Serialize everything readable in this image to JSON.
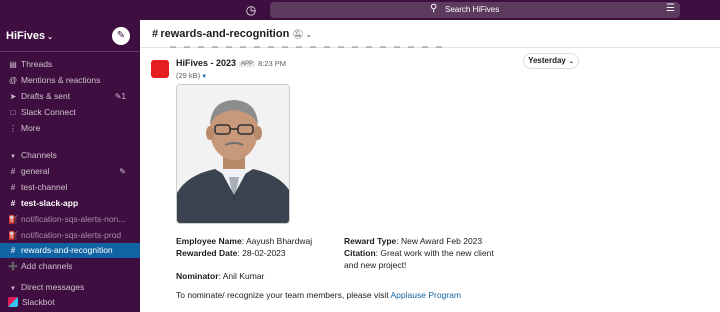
{
  "topbar": {
    "history_icon": "clock-icon",
    "search_placeholder": "Search HiFives",
    "search_icon": "search-icon",
    "filter_icon": "sliders-icon"
  },
  "sidebar": {
    "workspace": "HiFives",
    "compose_icon": "compose-icon",
    "top_items": [
      {
        "icon": "threads-icon",
        "label": "Threads"
      },
      {
        "icon": "at-icon",
        "label": "Mentions & reactions"
      },
      {
        "icon": "send-icon",
        "label": "Drafts & sent",
        "count": "1"
      },
      {
        "icon": "connect-icon",
        "label": "Slack Connect"
      },
      {
        "icon": "more-icon",
        "label": "More"
      }
    ],
    "channels_header": "Channels",
    "channels": [
      {
        "label": "general",
        "type": "public"
      },
      {
        "label": "test-channel",
        "type": "public"
      },
      {
        "label": "test-slack-app",
        "type": "public",
        "bold": true
      },
      {
        "label": "notification-sqs-alerts-non...",
        "type": "private"
      },
      {
        "label": "notification-sqs-alerts-prod",
        "type": "private"
      },
      {
        "label": "rewards-and-recognition",
        "type": "public",
        "active": true
      }
    ],
    "add_channels": "Add channels",
    "dm_header": "Direct messages",
    "dms": [
      {
        "label": "Slackbot"
      }
    ]
  },
  "channel": {
    "name": "rewards-and-recognition",
    "date_divider": "Yesterday"
  },
  "message": {
    "sender": "HiFives - 2023",
    "badge": "APP",
    "time": "8:23 PM",
    "file_size": "(29 kB)",
    "employee_name_label": "Employee Name",
    "employee_name": "Aayush Bhardwaj",
    "rewarded_date_label": "Rewarded Date",
    "rewarded_date": "28-02-2023",
    "reward_type_label": "Reward Type",
    "reward_type": "New Award Feb 2023",
    "citation_label": "Citation",
    "citation": "Great work with the new client and new project!",
    "nominator_label": "Nominator",
    "nominator": "Anil Kumar",
    "footer_text": "To nominate/ recognize your team members, please visit",
    "footer_link": "Applause Program"
  }
}
